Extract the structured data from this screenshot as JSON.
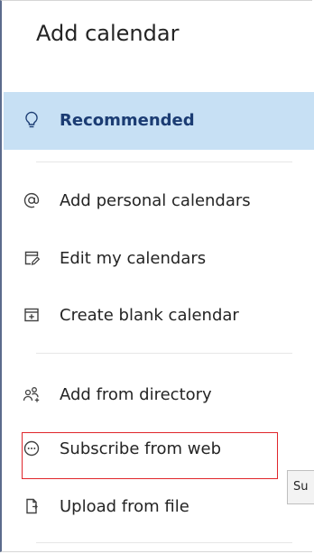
{
  "panel": {
    "title": "Add calendar"
  },
  "nav": {
    "recommended": {
      "label": "Recommended",
      "icon": "lightbulb-icon"
    },
    "add_personal": {
      "label": "Add personal calendars",
      "icon": "at-sign-icon"
    },
    "edit_my": {
      "label": "Edit my calendars",
      "icon": "edit-calendar-icon"
    },
    "create_blank": {
      "label": "Create blank calendar",
      "icon": "calendar-add-icon"
    },
    "add_directory": {
      "label": "Add from directory",
      "icon": "people-add-icon"
    },
    "subscribe_web": {
      "label": "Subscribe from web",
      "icon": "link-circle-icon"
    },
    "upload_file": {
      "label": "Upload from file",
      "icon": "document-arrow-icon"
    }
  },
  "tooltip": {
    "text": "Su"
  },
  "colors": {
    "selected_bg": "#c7e0f4",
    "selected_text": "#1b3c73",
    "highlight_border": "#e0262b"
  }
}
